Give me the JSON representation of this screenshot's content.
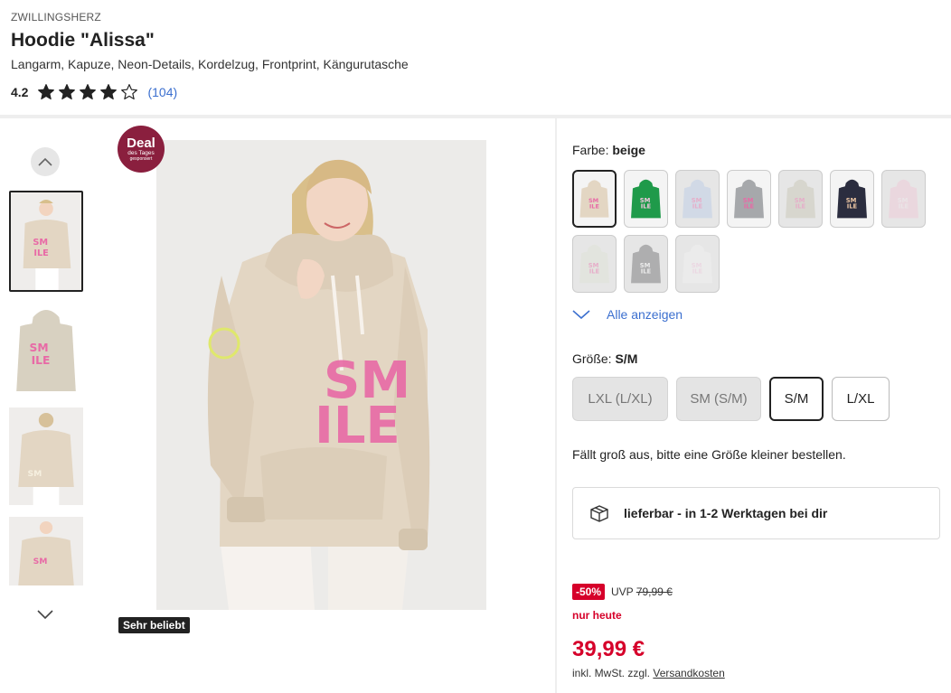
{
  "product": {
    "brand": "ZWILLINGSHERZ",
    "title": "Hoodie \"Alissa\"",
    "subtitle": "Langarm, Kapuze, Neon-Details, Kordelzug, Frontprint, Kängurutasche",
    "rating_value": "4.2",
    "rating_stars": 4,
    "rating_max": 5,
    "rating_count": "(104)"
  },
  "gallery": {
    "deal_badge": {
      "main": "Deal",
      "sub": "des Tages",
      "sub2": "gesponsert"
    },
    "popular_badge": "Sehr beliebt",
    "thumbnails": 4,
    "up_icon": "chevron-up-icon",
    "down_icon": "chevron-down-icon"
  },
  "color": {
    "label": "Farbe:",
    "selected": "beige",
    "swatches": [
      {
        "color": "#e3d6c3",
        "print": "#e86aa6",
        "selected": true,
        "disabled": false
      },
      {
        "color": "#1f9a4a",
        "print": "#f2c7df",
        "selected": false,
        "disabled": false
      },
      {
        "color": "#b9cbe8",
        "print": "#e86aa6",
        "selected": false,
        "disabled": true
      },
      {
        "color": "#a6a8ab",
        "print": "#e86aa6",
        "selected": false,
        "disabled": false
      },
      {
        "color": "#c5c4b2",
        "print": "#e86aa6",
        "selected": false,
        "disabled": true
      },
      {
        "color": "#2b2d3f",
        "print": "#f0c9a6",
        "selected": false,
        "disabled": false
      },
      {
        "color": "#f1c6d6",
        "print": "#f0e4ea",
        "selected": false,
        "disabled": true
      },
      {
        "color": "#dfe3d6",
        "print": "#e86aa6",
        "selected": false,
        "disabled": true
      },
      {
        "color": "#6c6c6e",
        "print": "#f2f2f2",
        "selected": false,
        "disabled": true
      },
      {
        "color": "#f3f3f3",
        "print": "#f2c7df",
        "selected": false,
        "disabled": true
      }
    ],
    "show_all": "Alle anzeigen"
  },
  "size": {
    "label": "Größe:",
    "selected": "S/M",
    "options": [
      {
        "label": "LXL (L/XL)",
        "disabled": true,
        "selected": false
      },
      {
        "label": "SM (S/M)",
        "disabled": true,
        "selected": false
      },
      {
        "label": "S/M",
        "disabled": false,
        "selected": true
      },
      {
        "label": "L/XL",
        "disabled": false,
        "selected": false
      }
    ],
    "hint": "Fällt groß aus, bitte eine Größe kleiner bestellen."
  },
  "delivery": {
    "icon": "package-icon",
    "text": "lieferbar - in 1-2 Werktagen bei dir"
  },
  "pricing": {
    "discount": "-50%",
    "uvp_label": "UVP",
    "uvp_price": "79,99 €",
    "today_label": "nur heute",
    "price": "39,99 €",
    "tax_text": "inkl. MwSt. zzgl.",
    "shipping_link": "Versandkosten"
  },
  "colors": {
    "accent": "#3b6fcf",
    "sale": "#d6002a",
    "deal": "#8a1f3e"
  }
}
